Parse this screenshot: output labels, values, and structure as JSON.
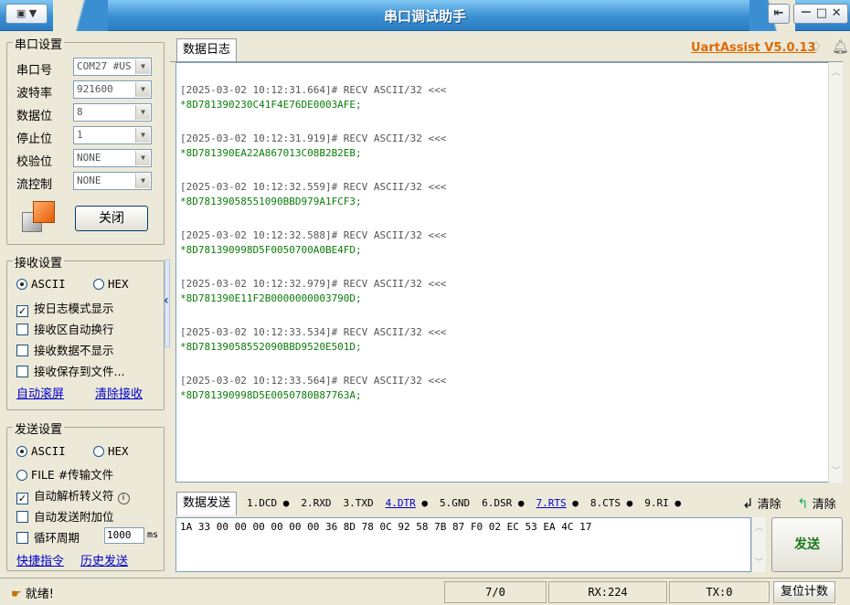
{
  "window": {
    "title": "串口调试助手",
    "sysmenu": "▼",
    "controls": [
      "⇤",
      "－",
      "□",
      "✕"
    ]
  },
  "port_settings": {
    "group_label": "串口设置",
    "fields": [
      {
        "label": "串口号",
        "value": "COM27 #US"
      },
      {
        "label": "波特率",
        "value": "921600"
      },
      {
        "label": "数据位",
        "value": "8"
      },
      {
        "label": "停止位",
        "value": "1"
      },
      {
        "label": "校验位",
        "value": "NONE"
      },
      {
        "label": "流控制",
        "value": "NONE"
      }
    ],
    "close_button": "关闭"
  },
  "receive_settings": {
    "group_label": "接收设置",
    "mode_ascii": "ASCII",
    "mode_hex": "HEX",
    "options": [
      {
        "label": "按日志模式显示",
        "checked": true
      },
      {
        "label": "接收区自动换行",
        "checked": false
      },
      {
        "label": "接收数据不显示",
        "checked": false
      },
      {
        "label": "接收保存到文件...",
        "checked": false
      }
    ],
    "link_autoscroll": "自动滚屏",
    "link_clear": "清除接收"
  },
  "send_settings": {
    "group_label": "发送设置",
    "mode_ascii": "ASCII",
    "mode_hex": "HEX",
    "mode_file": "FILE #传输文件",
    "opt_parse": "自动解析转义符",
    "opt_append": "自动发送附加位",
    "opt_cycle": "循环周期",
    "cycle_value": "1000",
    "cycle_unit": "ms",
    "link_shortcut": "快捷指令",
    "link_history": "历史发送"
  },
  "log": {
    "tab_label": "数据日志",
    "brand": "UartAssist V5.0.13",
    "entries": [
      {
        "header": "[2025-03-02 10:12:31.664]# RECV ASCII/32 <<<",
        "data": "*8D781390230C41F4E76DE0003AFE;"
      },
      {
        "header": "[2025-03-02 10:12:31.919]# RECV ASCII/32 <<<",
        "data": "*8D781390EA22A867013C08B2B2EB;"
      },
      {
        "header": "[2025-03-02 10:12:32.559]# RECV ASCII/32 <<<",
        "data": "*8D78139058551090BBD979A1FCF3;"
      },
      {
        "header": "[2025-03-02 10:12:32.588]# RECV ASCII/32 <<<",
        "data": "*8D781390998D5F0050700A0BE4FD;"
      },
      {
        "header": "[2025-03-02 10:12:32.979]# RECV ASCII/32 <<<",
        "data": "*8D781390E11F2B0000000003790D;"
      },
      {
        "header": "[2025-03-02 10:12:33.534]# RECV ASCII/32 <<<",
        "data": "*8D78139058552090BBD9520E501D;"
      },
      {
        "header": "[2025-03-02 10:12:33.564]# RECV ASCII/32 <<<",
        "data": "*8D781390998D5E0050780B87763A;"
      }
    ]
  },
  "send": {
    "tab_label": "数据发送",
    "pins": [
      {
        "label": "1.DCD",
        "dot": true,
        "link": false
      },
      {
        "label": "2.RXD",
        "dot": false,
        "link": false
      },
      {
        "label": "3.TXD",
        "dot": false,
        "link": false
      },
      {
        "label": "4.DTR",
        "dot": true,
        "link": true
      },
      {
        "label": "5.GND",
        "dot": false,
        "link": false
      },
      {
        "label": "6.DSR",
        "dot": true,
        "link": false
      },
      {
        "label": "7.RTS",
        "dot": true,
        "link": true
      },
      {
        "label": "8.CTS",
        "dot": true,
        "link": false
      },
      {
        "label": "9.RI",
        "dot": true,
        "link": false
      }
    ],
    "clear1": "清除",
    "clear2": "清除",
    "input_value": "1A 33 00 00 00 00 00 00 36 8D 78 0C 92 58 7B 87 F0 02 EC 53 EA 4C 17",
    "send_button": "发送"
  },
  "status": {
    "ready": "就绪!",
    "count": "7/0",
    "rx": "RX:224",
    "tx": "TX:0",
    "reset": "复位计数"
  },
  "colors": {
    "title_blue": "#3a8fd2",
    "log_green": "#0b7d0b",
    "brand_orange": "#e06a00",
    "send_green": "#1a7a1a"
  }
}
